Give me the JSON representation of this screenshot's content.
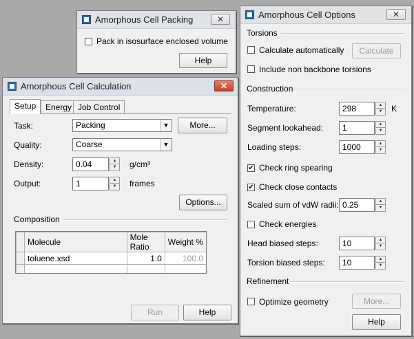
{
  "packing_window": {
    "title": "Amorphous Cell Packing",
    "close_glyph": "✕",
    "isosurface_label": "Pack in isosurface enclosed volume",
    "help_label": "Help"
  },
  "calc_window": {
    "title": "Amorphous Cell Calculation",
    "close_glyph": "✕",
    "tabs": [
      {
        "label": "Setup"
      },
      {
        "label": "Energy"
      },
      {
        "label": "Job Control"
      }
    ],
    "task_label": "Task:",
    "task_value": "Packing",
    "more_label": "More...",
    "quality_label": "Quality:",
    "quality_value": "Coarse",
    "density_label": "Density:",
    "density_value": "0.04",
    "density_unit": "g/cm³",
    "output_label": "Output:",
    "output_value": "1",
    "output_unit": "frames",
    "options_label": "Options...",
    "composition_label": "Composition",
    "table": {
      "headers": [
        "Molecule",
        "Mole Ratio",
        "Weight %"
      ],
      "rows": [
        [
          "toluene.xsd",
          "1.0",
          "100.0"
        ],
        [
          "",
          "",
          ""
        ]
      ]
    },
    "run_label": "Run",
    "help_label": "Help"
  },
  "options_window": {
    "title": "Amorphous Cell Options",
    "close_glyph": "✕",
    "torsions_label": "Torsions",
    "calc_auto_label": "Calculate automatically",
    "calculate_label": "Calculate",
    "non_backbone_label": "Include non backbone torsions",
    "construction_label": "Construction",
    "temperature_label": "Temperature:",
    "temperature_value": "298",
    "temperature_unit": "K",
    "segment_label": "Segment lookahead:",
    "segment_value": "1",
    "loading_label": "Loading steps:",
    "loading_value": "1000",
    "ring_label": "Check ring spearing",
    "close_contacts_label": "Check close contacts",
    "vdw_label": "Scaled sum of vdW radii:",
    "vdw_value": "0.25",
    "energies_label": "Check energies",
    "head_label": "Head biased steps:",
    "head_value": "10",
    "torsion_label": "Torsion biased steps:",
    "torsion_value": "10",
    "refinement_label": "Refinement",
    "optimize_label": "Optimize geometry",
    "more_label": "More...",
    "help_label": "Help",
    "check_glyph": "✔"
  },
  "glyphs": {
    "arrow_down": "▼",
    "spin_up": "▲",
    "spin_down": "▼"
  }
}
